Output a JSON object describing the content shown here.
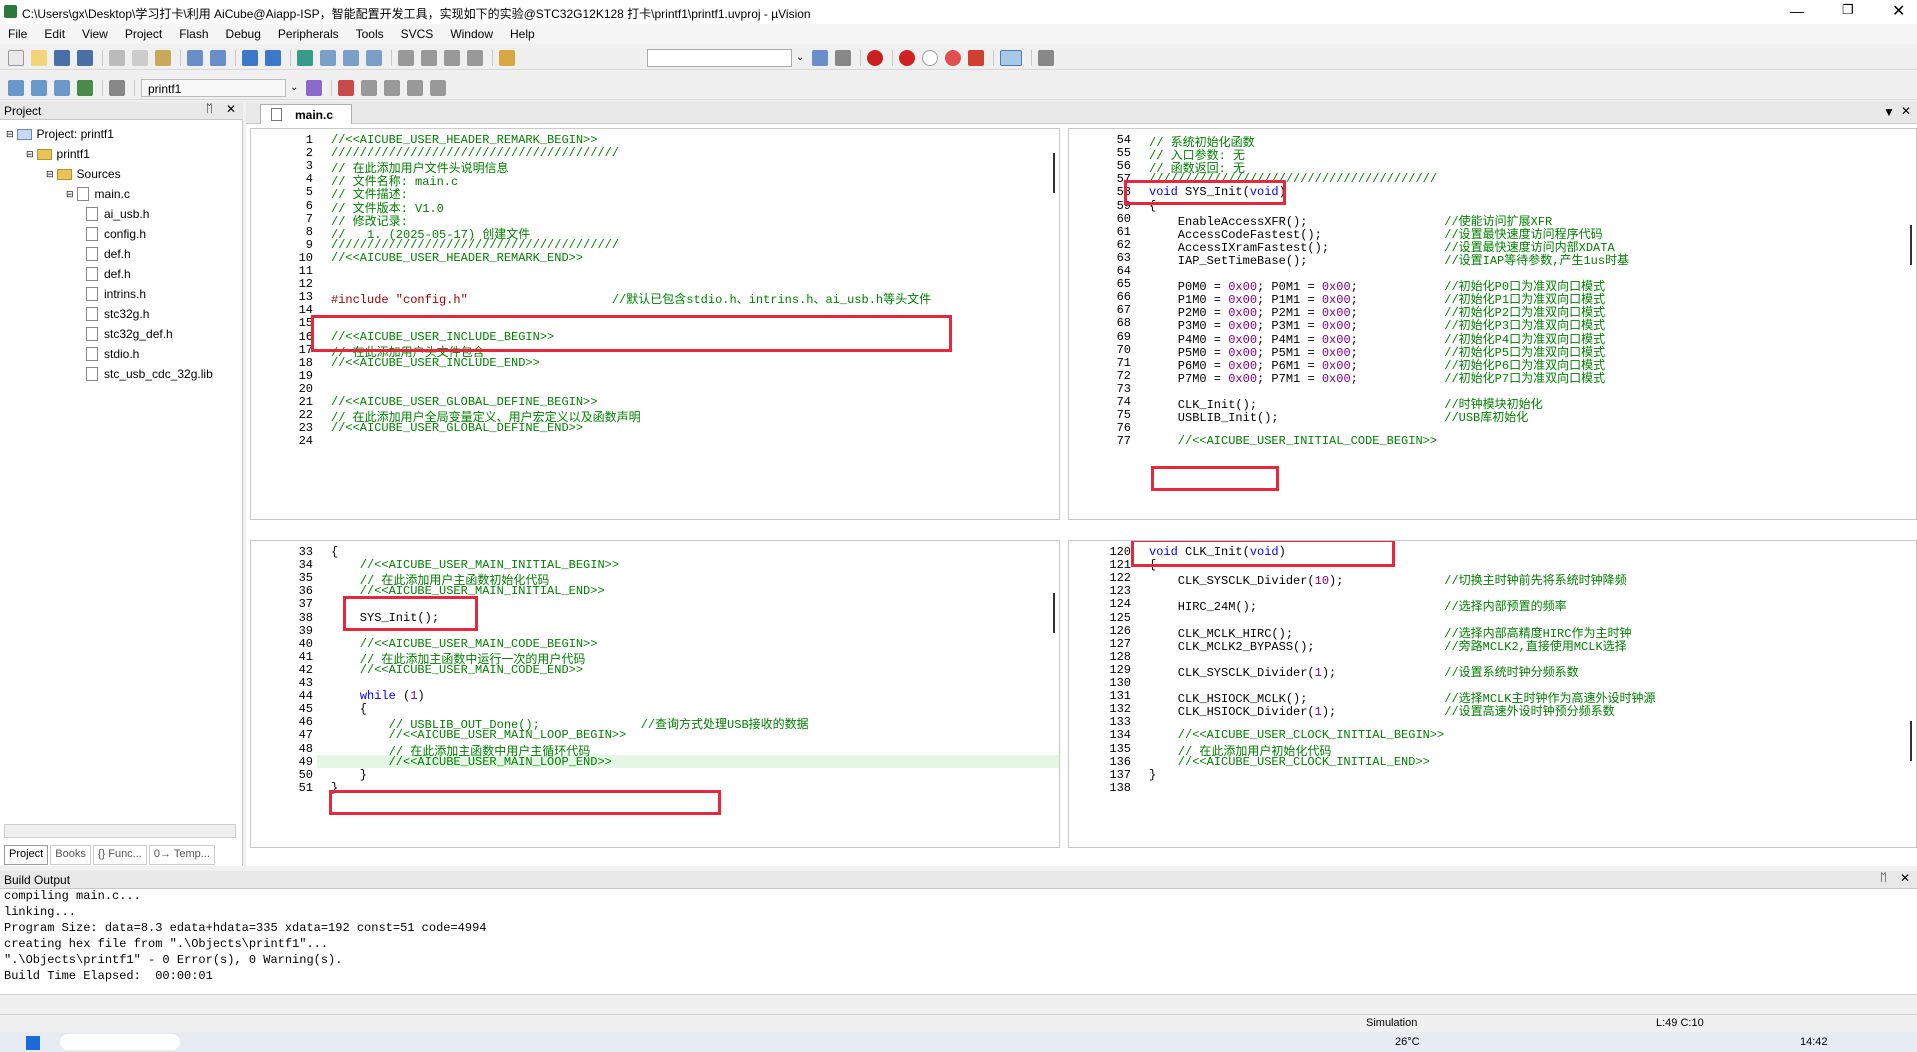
{
  "title": "C:\\Users\\gx\\Desktop\\学习打卡\\利用 AiCube@Aiapp-ISP，智能配置开发工具，实现如下的实验@STC32G12K128 打卡\\printf1\\printf1.uvproj - µVision",
  "menu": [
    "File",
    "Edit",
    "View",
    "Project",
    "Flash",
    "Debug",
    "Peripherals",
    "Tools",
    "SVCS",
    "Window",
    "Help"
  ],
  "toolbar": {
    "target": "printf1"
  },
  "project_panel": {
    "header": "Project",
    "root": "Project: printf1",
    "target": "printf1",
    "group": "Sources",
    "main_file": "main.c",
    "headers": [
      "ai_usb.h",
      "config.h",
      "def.h",
      "def.h",
      "intrins.h",
      "stc32g.h",
      "stc32g_def.h",
      "stdio.h"
    ],
    "lib": "stc_usb_cdc_32g.lib",
    "tabs": [
      "Project",
      "Books",
      "{} Func...",
      "0→ Temp..."
    ]
  },
  "editor_tab": "main.c",
  "pane_tl": {
    "lines": [
      {
        "n": "1",
        "t": "//<<AICUBE_USER_HEADER_REMARK_BEGIN>>",
        "c": "cmt"
      },
      {
        "n": "2",
        "t": "////////////////////////////////////////",
        "c": "cmt"
      },
      {
        "n": "3",
        "t": "// 在此添加用户文件头说明信息",
        "c": "cmt"
      },
      {
        "n": "4",
        "t": "// 文件名称: main.c",
        "c": "cmt"
      },
      {
        "n": "5",
        "t": "// 文件描述:",
        "c": "cmt"
      },
      {
        "n": "6",
        "t": "// 文件版本: V1.0",
        "c": "cmt"
      },
      {
        "n": "7",
        "t": "// 修改记录:",
        "c": "cmt"
      },
      {
        "n": "8",
        "t": "//   1. (2025-05-17) 创建文件",
        "c": "cmt"
      },
      {
        "n": "9",
        "t": "////////////////////////////////////////",
        "c": "cmt"
      },
      {
        "n": "10",
        "t": "//<<AICUBE_USER_HEADER_REMARK_END>>",
        "c": "cmt"
      },
      {
        "n": "11",
        "t": "",
        "c": ""
      },
      {
        "n": "12",
        "t": "",
        "c": ""
      },
      {
        "n": "13",
        "t": "#include \"config.h\"                    //默认已包含stdio.h、intrins.h、ai_usb.h等头文件",
        "c": "inc"
      },
      {
        "n": "14",
        "t": "",
        "c": ""
      },
      {
        "n": "15",
        "t": "",
        "c": ""
      },
      {
        "n": "16",
        "t": "//<<AICUBE_USER_INCLUDE_BEGIN>>",
        "c": "cmt"
      },
      {
        "n": "17",
        "t": "// 在此添加用户头文件包含",
        "c": "cmt"
      },
      {
        "n": "18",
        "t": "//<<AICUBE_USER_INCLUDE_END>>",
        "c": "cmt"
      },
      {
        "n": "19",
        "t": "",
        "c": ""
      },
      {
        "n": "20",
        "t": "",
        "c": ""
      },
      {
        "n": "21",
        "t": "//<<AICUBE_USER_GLOBAL_DEFINE_BEGIN>>",
        "c": "cmt"
      },
      {
        "n": "22",
        "t": "// 在此添加用户全局变量定义、用户宏定义以及函数声明",
        "c": "cmt"
      },
      {
        "n": "23",
        "t": "//<<AICUBE_USER_GLOBAL_DEFINE_END>>",
        "c": "cmt"
      },
      {
        "n": "24",
        "t": "",
        "c": ""
      }
    ]
  },
  "pane_tr": {
    "lines": [
      {
        "n": "54",
        "t": "// 系统初始化函数",
        "c": "cmt"
      },
      {
        "n": "55",
        "t": "// 入口参数: 无",
        "c": "cmt"
      },
      {
        "n": "56",
        "t": "// 函数返回: 无",
        "c": "cmt"
      },
      {
        "n": "57",
        "t": "////////////////////////////////////////",
        "c": "cmt"
      },
      {
        "n": "58",
        "t": "void SYS_Init(void)",
        "c": "fn"
      },
      {
        "n": "59",
        "t": "{",
        "c": ""
      },
      {
        "n": "60",
        "t": "    EnableAccessXFR();                   //使能访问扩展XFR",
        "c": "mix"
      },
      {
        "n": "61",
        "t": "    AccessCodeFastest();                 //设置最快速度访问程序代码",
        "c": "mix"
      },
      {
        "n": "62",
        "t": "    AccessIXramFastest();                //设置最快速度访问内部XDATA",
        "c": "mix"
      },
      {
        "n": "63",
        "t": "    IAP_SetTimeBase();                   //设置IAP等待参数,产生1us时基",
        "c": "mix"
      },
      {
        "n": "64",
        "t": "",
        "c": ""
      },
      {
        "n": "65",
        "t": "    P0M0 = 0x00; P0M1 = 0x00;            //初始化P0口为准双向口模式",
        "c": "mix"
      },
      {
        "n": "66",
        "t": "    P1M0 = 0x00; P1M1 = 0x00;            //初始化P1口为准双向口模式",
        "c": "mix"
      },
      {
        "n": "67",
        "t": "    P2M0 = 0x00; P2M1 = 0x00;            //初始化P2口为准双向口模式",
        "c": "mix"
      },
      {
        "n": "68",
        "t": "    P3M0 = 0x00; P3M1 = 0x00;            //初始化P3口为准双向口模式",
        "c": "mix"
      },
      {
        "n": "69",
        "t": "    P4M0 = 0x00; P4M1 = 0x00;            //初始化P4口为准双向口模式",
        "c": "mix"
      },
      {
        "n": "70",
        "t": "    P5M0 = 0x00; P5M1 = 0x00;            //初始化P5口为准双向口模式",
        "c": "mix"
      },
      {
        "n": "71",
        "t": "    P6M0 = 0x00; P6M1 = 0x00;            //初始化P6口为准双向口模式",
        "c": "mix"
      },
      {
        "n": "72",
        "t": "    P7M0 = 0x00; P7M1 = 0x00;            //初始化P7口为准双向口模式",
        "c": "mix"
      },
      {
        "n": "73",
        "t": "",
        "c": ""
      },
      {
        "n": "74",
        "t": "    CLK_Init();                          //时钟模块初始化",
        "c": "mix"
      },
      {
        "n": "75",
        "t": "    USBLIB_Init();                       //USB库初始化",
        "c": "mix"
      },
      {
        "n": "76",
        "t": "",
        "c": ""
      },
      {
        "n": "77",
        "t": "    //<<AICUBE_USER_INITIAL_CODE_BEGIN>>",
        "c": "cmt"
      }
    ]
  },
  "pane_bl": {
    "lines": [
      {
        "n": "33",
        "t": "{",
        "c": ""
      },
      {
        "n": "34",
        "t": "    //<<AICUBE_USER_MAIN_INITIAL_BEGIN>>",
        "c": "cmt"
      },
      {
        "n": "35",
        "t": "    // 在此添加用户主函数初始化代码",
        "c": "cmt"
      },
      {
        "n": "36",
        "t": "    //<<AICUBE_USER_MAIN_INITIAL_END>>",
        "c": "cmt"
      },
      {
        "n": "37",
        "t": "",
        "c": ""
      },
      {
        "n": "38",
        "t": "    SYS_Init();",
        "c": ""
      },
      {
        "n": "39",
        "t": "",
        "c": ""
      },
      {
        "n": "40",
        "t": "    //<<AICUBE_USER_MAIN_CODE_BEGIN>>",
        "c": "cmt"
      },
      {
        "n": "41",
        "t": "    // 在此添加主函数中运行一次的用户代码",
        "c": "cmt"
      },
      {
        "n": "42",
        "t": "    //<<AICUBE_USER_MAIN_CODE_END>>",
        "c": "cmt"
      },
      {
        "n": "43",
        "t": "",
        "c": ""
      },
      {
        "n": "44",
        "t": "    while (1)",
        "c": "while"
      },
      {
        "n": "45",
        "t": "    {",
        "c": ""
      },
      {
        "n": "46",
        "t": "        // USBLIB_OUT_Done();              //查询方式处理USB接收的数据",
        "c": "cmt"
      },
      {
        "n": "47",
        "t": "        //<<AICUBE_USER_MAIN_LOOP_BEGIN>>",
        "c": "cmt"
      },
      {
        "n": "48",
        "t": "        // 在此添加主函数中用户主循环代码",
        "c": "cmt"
      },
      {
        "n": "49",
        "t": "        //<<AICUBE_USER_MAIN_LOOP_END>>",
        "c": "cmt"
      },
      {
        "n": "50",
        "t": "    }",
        "c": ""
      },
      {
        "n": "51",
        "t": "}",
        "c": ""
      }
    ]
  },
  "pane_br": {
    "lines": [
      {
        "n": "120",
        "t": "void CLK_Init(void)",
        "c": "fn"
      },
      {
        "n": "121",
        "t": "{",
        "c": ""
      },
      {
        "n": "122",
        "t": "    CLK_SYSCLK_Divider(10);              //切换主时钟前先将系统时钟降频",
        "c": "mix"
      },
      {
        "n": "123",
        "t": "",
        "c": ""
      },
      {
        "n": "124",
        "t": "    HIRC_24M();                          //选择内部预置的频率",
        "c": "mix"
      },
      {
        "n": "125",
        "t": "",
        "c": ""
      },
      {
        "n": "126",
        "t": "    CLK_MCLK_HIRC();                     //选择内部高精度HIRC作为主时钟",
        "c": "mix"
      },
      {
        "n": "127",
        "t": "    CLK_MCLK2_BYPASS();                  //旁路MCLK2,直接使用MCLK选择",
        "c": "mix"
      },
      {
        "n": "128",
        "t": "",
        "c": ""
      },
      {
        "n": "129",
        "t": "    CLK_SYSCLK_Divider(1);               //设置系统时钟分频系数",
        "c": "mix"
      },
      {
        "n": "130",
        "t": "",
        "c": ""
      },
      {
        "n": "131",
        "t": "    CLK_HSIOCK_MCLK();                   //选择MCLK主时钟作为高速外设时钟源",
        "c": "mix"
      },
      {
        "n": "132",
        "t": "    CLK_HSIOCK_Divider(1);               //设置高速外设时钟预分频系数",
        "c": "mix"
      },
      {
        "n": "133",
        "t": "",
        "c": ""
      },
      {
        "n": "134",
        "t": "    //<<AICUBE_USER_CLOCK_INITIAL_BEGIN>>",
        "c": "cmt"
      },
      {
        "n": "135",
        "t": "    // 在此添加用户初始化代码",
        "c": "cmt"
      },
      {
        "n": "136",
        "t": "    //<<AICUBE_USER_CLOCK_INITIAL_END>>",
        "c": "cmt"
      },
      {
        "n": "137",
        "t": "}",
        "c": ""
      },
      {
        "n": "138",
        "t": "",
        "c": ""
      }
    ]
  },
  "build_output": {
    "header": "Build Output",
    "lines": [
      "compiling main.c...",
      "linking...",
      "Program Size: data=8.3 edata+hdata=335 xdata=192 const=51 code=4994",
      "creating hex file from \".\\Objects\\printf1\"...",
      "\".\\Objects\\printf1\" - 0 Error(s), 0 Warning(s).",
      "Build Time Elapsed:  00:00:01"
    ]
  },
  "status": {
    "mode": "Simulation",
    "pos": "L:49 C:10"
  },
  "taskbar": {
    "temp": "26°C",
    "time": "14:42"
  }
}
